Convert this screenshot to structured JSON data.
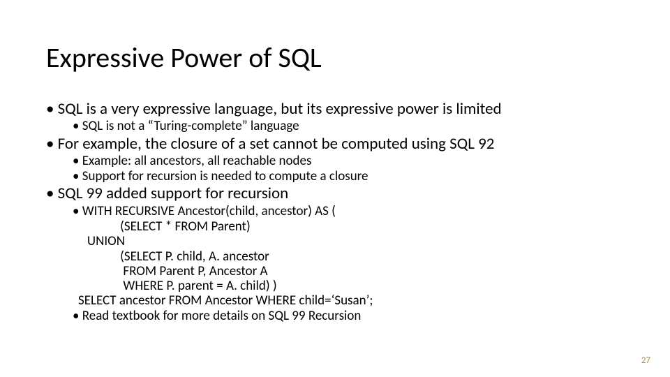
{
  "title": "Expressive Power of SQL",
  "bullets": [
    {
      "text": "SQL is a very expressive language, but its expressive power is limited",
      "sub": [
        "SQL is not a “Turing-complete” language"
      ]
    },
    {
      "text": "For example, the closure of a set cannot be computed using SQL 92",
      "sub": [
        "Example: all ancestors, all reachable nodes",
        "Support for recursion is needed to compute a closure"
      ]
    },
    {
      "text": "SQL 99 added support for recursion",
      "sub": [
        "WITH RECURSIVE Ancestor(child, ancestor) AS (",
        "Read textbook for more details on SQL 99 Recursion"
      ],
      "code": [
        "              (SELECT * FROM Parent)",
        "   UNION",
        "              (SELECT P. child, A. ancestor",
        "               FROM Parent P, Ancestor A",
        "               WHERE P. parent = A. child) )",
        "SELECT ancestor FROM Ancestor WHERE child=‘Susan’;"
      ]
    }
  ],
  "page": "27"
}
